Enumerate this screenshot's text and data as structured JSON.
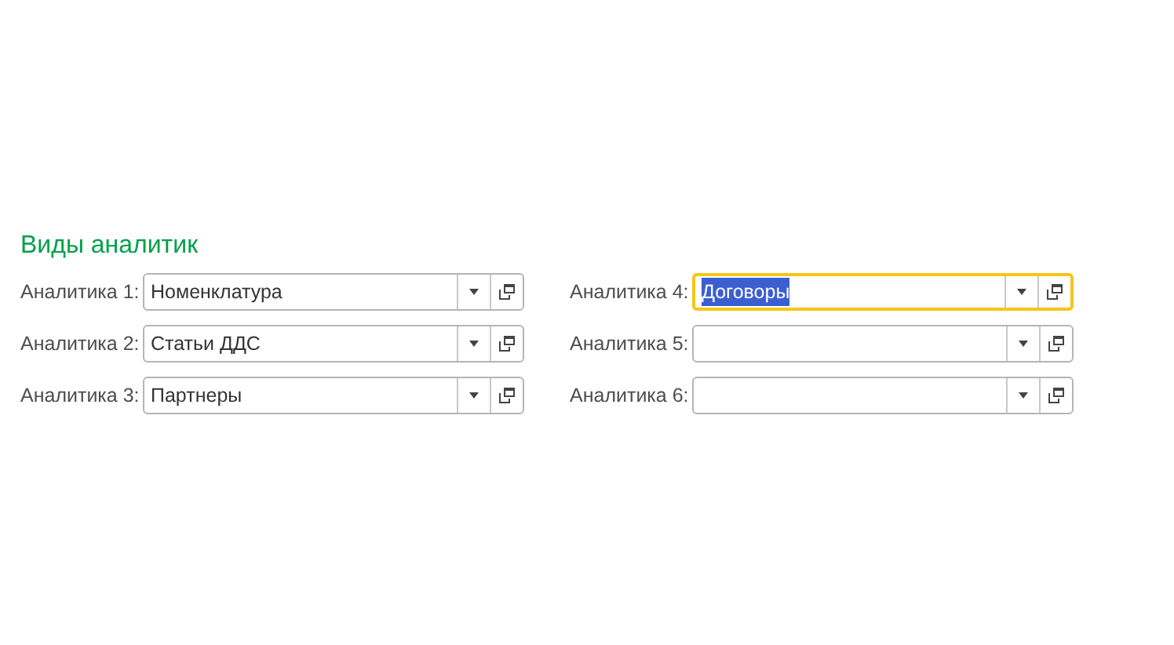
{
  "section": {
    "title": "Виды аналитик"
  },
  "columns": [
    {
      "fields": [
        {
          "label": "Аналитика 1:",
          "value": "Номенклатура",
          "focused": false
        },
        {
          "label": "Аналитика 2:",
          "value": "Статьи ДДС",
          "focused": false
        },
        {
          "label": "Аналитика 3:",
          "value": "Партнеры",
          "focused": false
        }
      ]
    },
    {
      "fields": [
        {
          "label": "Аналитика 4:",
          "value": "Договоры",
          "focused": true
        },
        {
          "label": "Аналитика 5:",
          "focused": false
        },
        {
          "label": "Аналитика 6:",
          "focused": false
        }
      ]
    }
  ]
}
